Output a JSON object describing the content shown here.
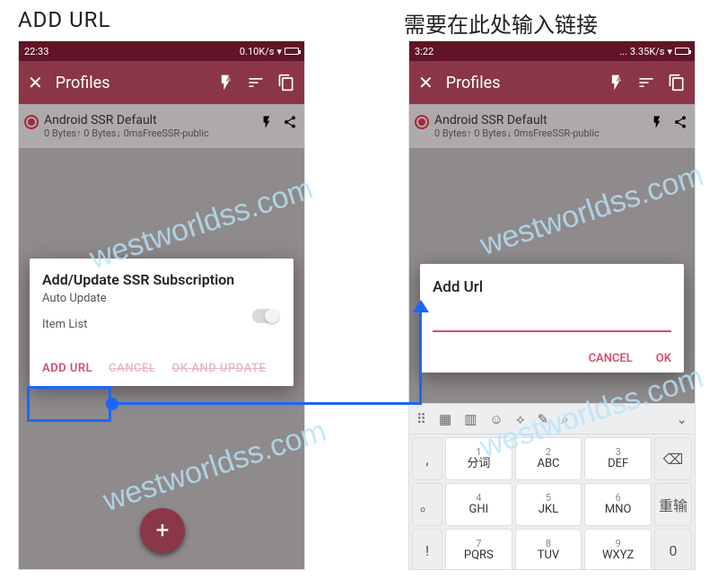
{
  "labels": {
    "left_title": "ADD URL",
    "right_title": "需要在此处输入链接"
  },
  "statusbar": {
    "left": {
      "time": "22:33",
      "net": "0.10K/s"
    },
    "right": {
      "time": "3:22",
      "net": "3.35K/s",
      "dots": "..."
    }
  },
  "appbar": {
    "title": "Profiles"
  },
  "profile": {
    "name": "Android SSR Default",
    "subtitle": "0 Bytes↑  0 Bytes↓ 0msFreeSSR-public"
  },
  "dialog1": {
    "title": "Add/Update SSR Subscription",
    "auto_update": "Auto Update",
    "item_list": "Item List",
    "add_url": "ADD URL",
    "cancel": "CANCEL",
    "ok_update": "OK AND UPDATE"
  },
  "dialog2": {
    "title": "Add Url",
    "cancel": "CANCEL",
    "ok": "OK"
  },
  "keyboard": {
    "rows": [
      [
        {
          "side": ","
        },
        {
          "num": "1",
          "ltr": "分词"
        },
        {
          "num": "2",
          "ltr": "ABC"
        },
        {
          "num": "3",
          "ltr": "DEF"
        },
        {
          "side": "⌫"
        }
      ],
      [
        {
          "side": "。"
        },
        {
          "num": "4",
          "ltr": "GHI"
        },
        {
          "num": "5",
          "ltr": "JKL"
        },
        {
          "num": "6",
          "ltr": "MNO"
        },
        {
          "side": "重输"
        }
      ],
      [
        {
          "side": "!"
        },
        {
          "num": "7",
          "ltr": "PQRS"
        },
        {
          "num": "8",
          "ltr": "TUV"
        },
        {
          "num": "9",
          "ltr": "WXYZ"
        },
        {
          "side": "0"
        }
      ]
    ],
    "toolbar_icons": [
      "⌗",
      "▦",
      "▥",
      "☺",
      "⊘",
      "✎",
      "⌕",
      "⌄"
    ]
  },
  "watermark": "westworldss.com",
  "fab": "+"
}
